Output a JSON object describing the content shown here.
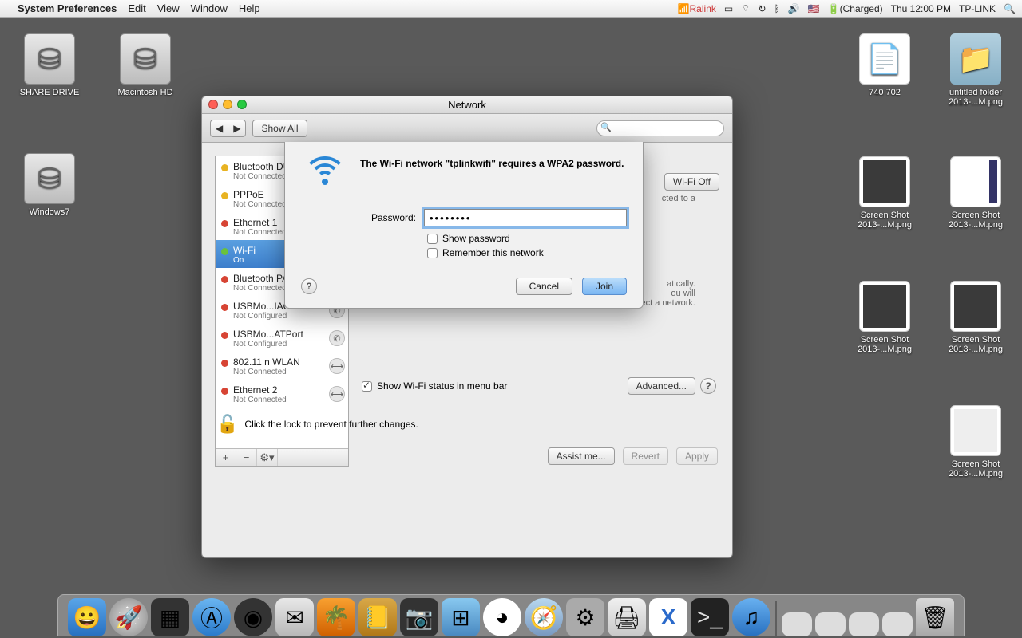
{
  "menubar": {
    "app": "System Preferences",
    "menus": [
      "Edit",
      "View",
      "Window",
      "Help"
    ],
    "ralink": "Ralink",
    "battery": "(Charged)",
    "clock": "Thu 12:00 PM",
    "user": "TP-LINK"
  },
  "desktop": {
    "share": "SHARE DRIVE",
    "machd": "Macintosh HD",
    "win7": "Windows7",
    "file1": "740 702",
    "folder1": "untitled folder\n2013-...M.png",
    "ss1": "Screen Shot\n2013-...M.png",
    "ss2": "Screen Shot\n2013-...M.png",
    "ss3": "Screen Shot\n2013-...M.png",
    "ss4": "Screen Shot\n2013-...M.png",
    "ss5": "Screen Shot\n2013-...M.png"
  },
  "window": {
    "title": "Network",
    "show_all": "Show All",
    "sidebar": [
      {
        "name": "Bluetooth DUN",
        "status": "Not Connected",
        "dot": "yellow"
      },
      {
        "name": "PPPoE",
        "status": "Not Connected",
        "dot": "yellow"
      },
      {
        "name": "Ethernet 1",
        "status": "Not Connected",
        "dot": "red"
      },
      {
        "name": "Wi-Fi",
        "status": "On",
        "dot": "green"
      },
      {
        "name": "Bluetooth PAN",
        "status": "Not Connected",
        "dot": "red"
      },
      {
        "name": "USBMo...IAGPort",
        "status": "Not Configured",
        "dot": "red"
      },
      {
        "name": "USBMo...ATPort",
        "status": "Not Configured",
        "dot": "red"
      },
      {
        "name": "802.11 n WLAN",
        "status": "Not Connected",
        "dot": "red"
      },
      {
        "name": "Ethernet 2",
        "status": "Not Connected",
        "dot": "red"
      }
    ],
    "wifi_off": "Wi-Fi Off",
    "connected_to": "cted to a",
    "note": "atically.\nou will\nhave to manually select a network.",
    "show_status": "Show Wi-Fi status in menu bar",
    "advanced": "Advanced...",
    "lock_text": "Click the lock to prevent further changes.",
    "assist": "Assist me...",
    "revert": "Revert",
    "apply": "Apply"
  },
  "sheet": {
    "message": "The Wi-Fi network \"tplinkwifi\" requires a WPA2 password.",
    "pwd_label": "Password:",
    "pwd_value": "••••••••",
    "show_pwd": "Show password",
    "remember": "Remember this network",
    "cancel": "Cancel",
    "join": "Join"
  }
}
